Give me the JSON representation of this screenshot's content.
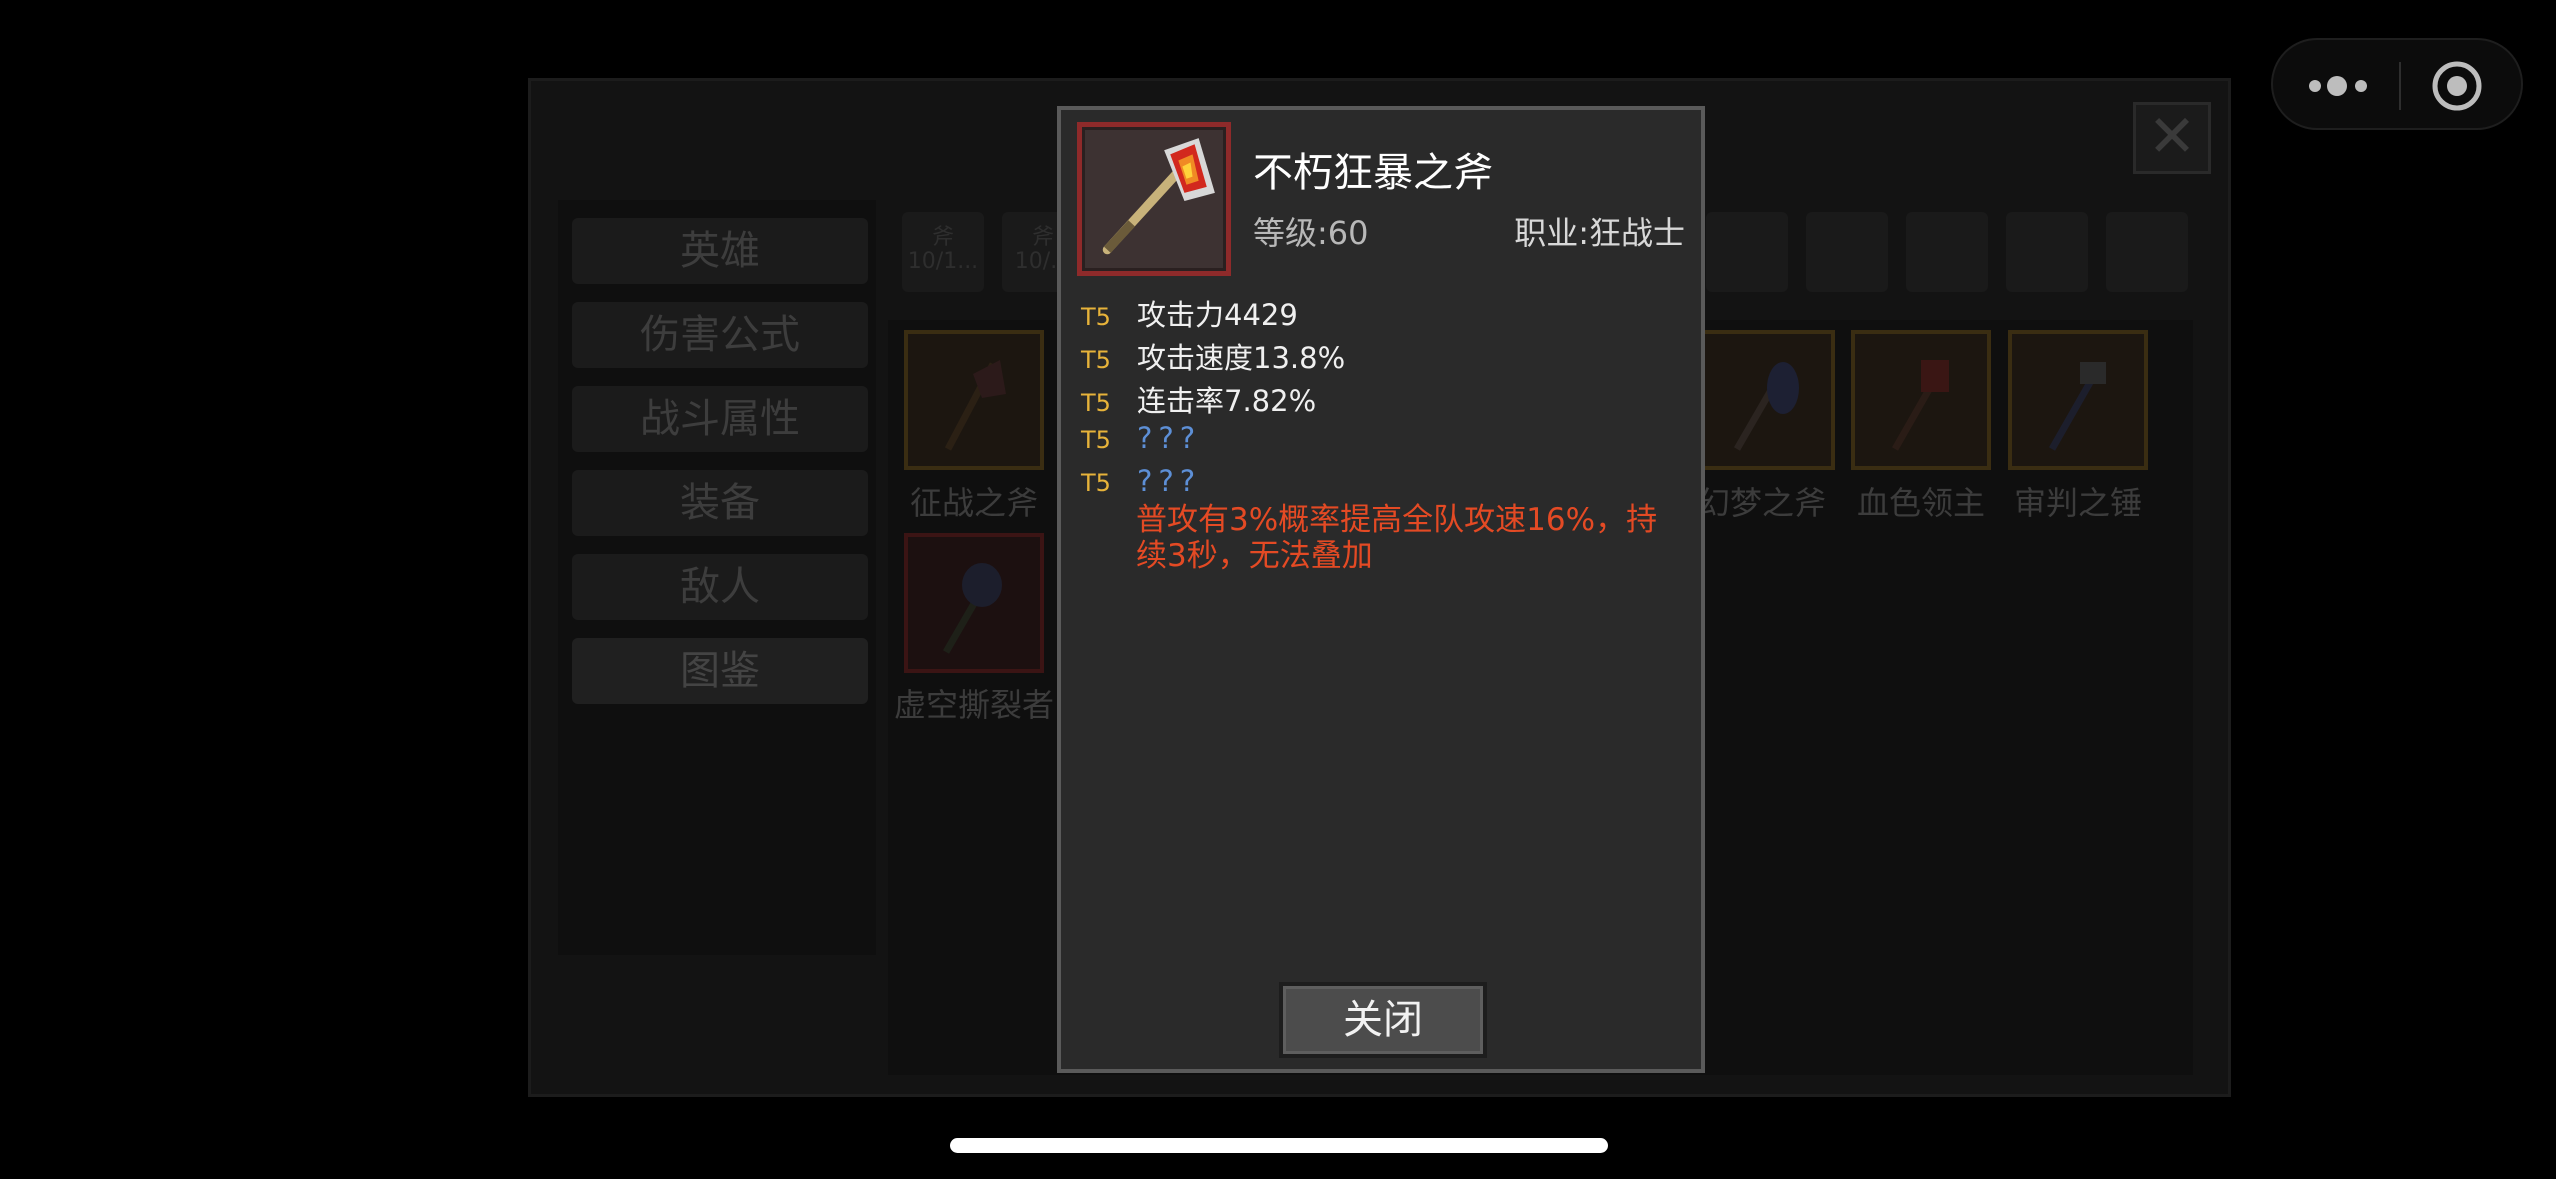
{
  "background": {
    "menu": [
      "英雄",
      "伤害公式",
      "战斗属性",
      "装备",
      "敌人",
      "图鉴"
    ],
    "tabs": [
      {
        "line1": "斧",
        "line2": "10/1..."
      },
      {
        "line1": "斧",
        "line2": "10/..."
      }
    ],
    "items": [
      {
        "label": "征战之斧",
        "quality": "gold"
      },
      {
        "label": "幻梦之斧",
        "quality": "gold"
      },
      {
        "label": "血色领主",
        "quality": "gold"
      },
      {
        "label": "审判之锤",
        "quality": "gold"
      },
      {
        "label": "虚空撕裂者",
        "quality": "red"
      }
    ]
  },
  "item": {
    "name": "不朽狂暴之斧",
    "level": "等级:60",
    "class": "职业:狂战士",
    "icon": "axe-icon",
    "frame_color": "#8e2a2a",
    "stats": [
      {
        "tier": "T5",
        "text": "攻击力4429",
        "known": true
      },
      {
        "tier": "T5",
        "text": "攻击速度13.8%",
        "known": true
      },
      {
        "tier": "T5",
        "text": "连击率7.82%",
        "known": true
      },
      {
        "tier": "T5",
        "text": "???",
        "known": false
      },
      {
        "tier": "T5",
        "text": "???",
        "known": false
      }
    ],
    "effect": "普攻有3%概率提高全队攻速16%，持续3秒，无法叠加"
  },
  "buttons": {
    "close": "关闭"
  },
  "colors": {
    "tier": "#e7b33a",
    "unknown": "#5d8fd6",
    "effect": "#e44a24"
  }
}
